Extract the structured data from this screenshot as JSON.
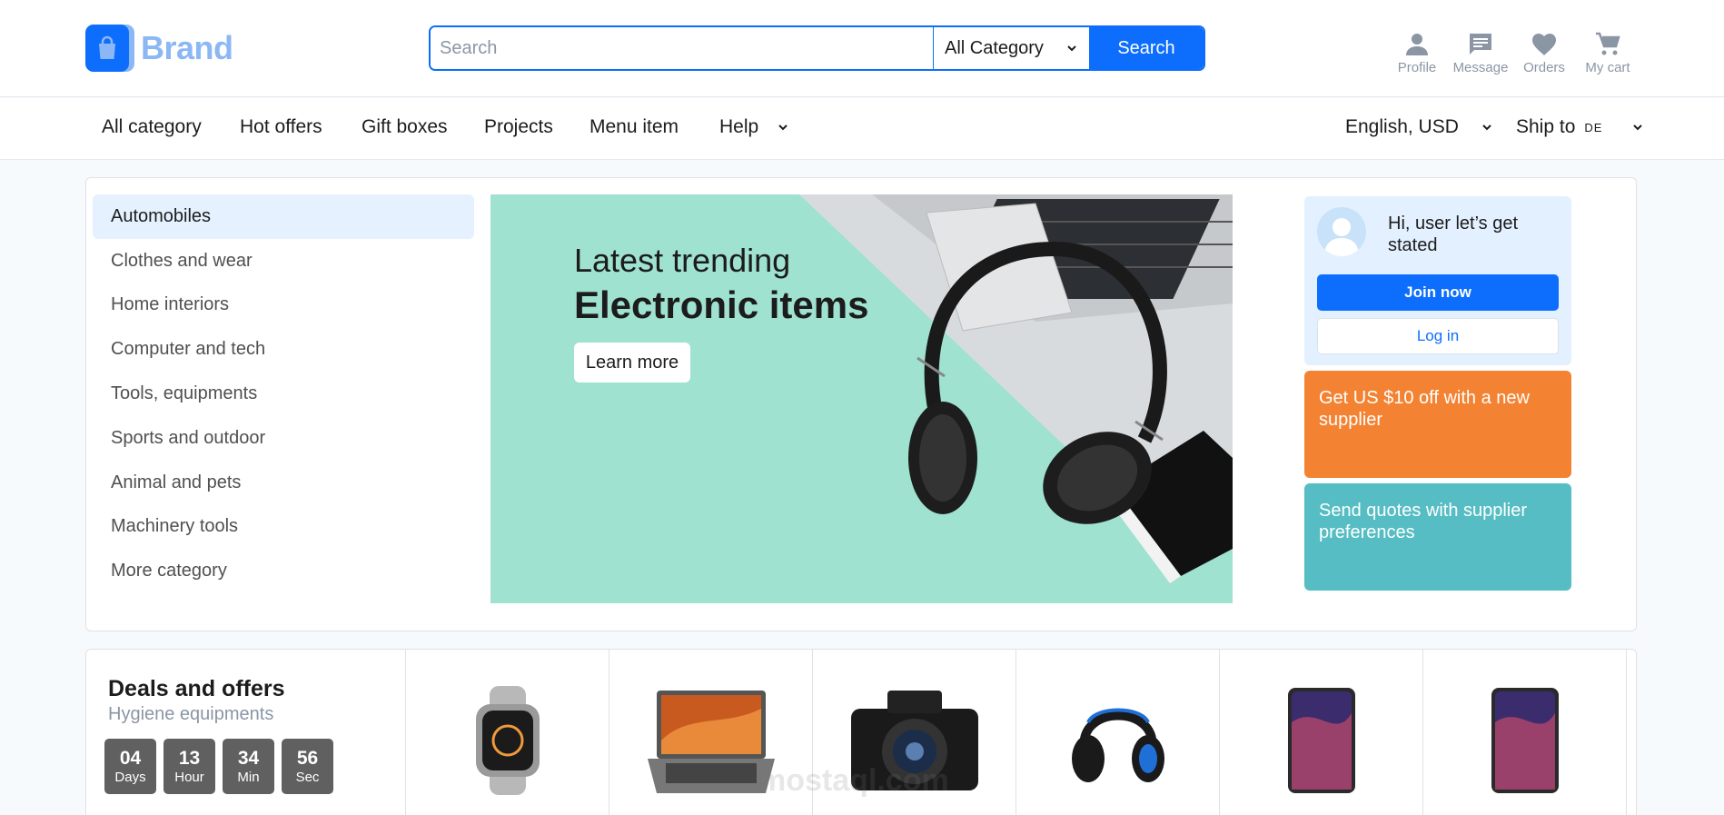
{
  "header": {
    "brand": "Brand",
    "search": {
      "placeholder": "Search",
      "category": "All Category",
      "button": "Search"
    },
    "actions": [
      {
        "label": "Profile",
        "icon": "person-icon"
      },
      {
        "label": "Message",
        "icon": "message-icon"
      },
      {
        "label": "Orders",
        "icon": "heart-icon"
      },
      {
        "label": "My cart",
        "icon": "cart-icon"
      }
    ]
  },
  "nav": {
    "items": [
      "All category",
      "Hot offers",
      "Gift boxes",
      "Projects",
      "Menu item",
      "Help"
    ],
    "language": "English, USD",
    "ship_label": "Ship to",
    "ship_country": "DE"
  },
  "categories": [
    "Automobiles",
    "Clothes and wear",
    "Home interiors",
    "Computer and tech",
    "Tools, equipments",
    "Sports and outdoor",
    "Animal and pets",
    "Machinery tools",
    "More category"
  ],
  "banner": {
    "line1": "Latest trending",
    "line2": "Electronic items",
    "button": "Learn more"
  },
  "user_card": {
    "greeting": "Hi, user let’s get stated",
    "join": "Join now",
    "login": "Log in"
  },
  "promos": [
    {
      "text": "Get US $10 off with a new supplier",
      "color": "#f38332"
    },
    {
      "text": "Send quotes with supplier preferences",
      "color": "#55bdc3"
    }
  ],
  "deals": {
    "title": "Deals and offers",
    "subtitle": "Hygiene equipments",
    "timer": [
      {
        "value": "04",
        "unit": "Days"
      },
      {
        "value": "13",
        "unit": "Hour"
      },
      {
        "value": "34",
        "unit": "Min"
      },
      {
        "value": "56",
        "unit": "Sec"
      }
    ],
    "products": [
      "smartwatch",
      "laptop",
      "camera",
      "headphones",
      "smartphone",
      "smartphone"
    ]
  },
  "watermark": "mostaql.com",
  "colors": {
    "primary": "#0d6efd",
    "brand_light": "#8cb7f5",
    "banner_bg": "#9fe2cf"
  }
}
